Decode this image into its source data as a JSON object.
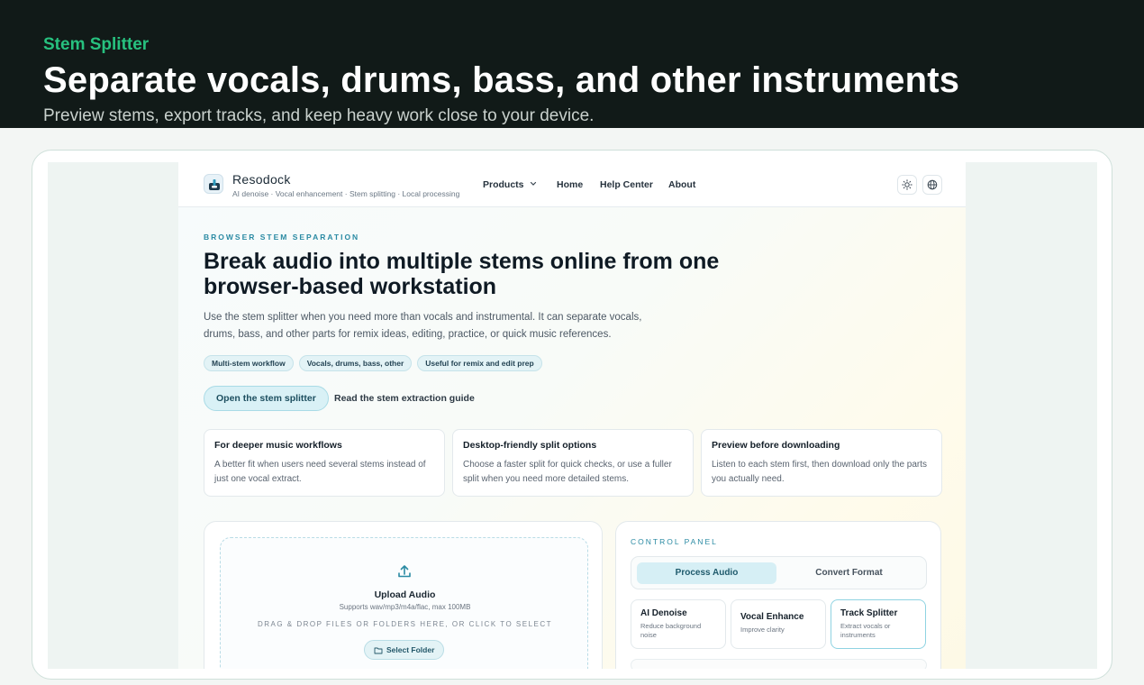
{
  "banner": {
    "eyebrow": "Stem Splitter",
    "headline": "Separate vocals, drums, bass, and other instruments",
    "subtitle": "Preview stems, export tracks, and keep heavy work close to your device."
  },
  "nav": {
    "brand": "Resodock",
    "tagline": "AI denoise · Vocal enhancement · Stem splitting · Local processing",
    "links": {
      "products": "Products",
      "home": "Home",
      "help": "Help Center",
      "about": "About"
    },
    "icons": {
      "theme": "sun-icon",
      "language": "globe-icon",
      "dropdown": "chevron-down-icon"
    }
  },
  "hero": {
    "kicker": "BROWSER STEM SEPARATION",
    "title": "Break audio into multiple stems online from one browser-based workstation",
    "lead": "Use the stem splitter when you need more than vocals and instrumental. It can separate vocals, drums, bass, and other parts for remix ideas, editing, practice, or quick music references.",
    "chips": [
      "Multi-stem workflow",
      "Vocals, drums, bass, other",
      "Useful for remix and edit prep"
    ],
    "primary_cta": "Open the stem splitter",
    "secondary_cta": "Read the stem extraction guide"
  },
  "features": [
    {
      "title": "For deeper music workflows",
      "desc": "A better fit when users need several stems instead of just one vocal extract."
    },
    {
      "title": "Desktop-friendly split options",
      "desc": "Choose a faster split for quick checks, or use a fuller split when you need more detailed stems."
    },
    {
      "title": "Preview before downloading",
      "desc": "Listen to each stem first, then download only the parts you actually need."
    }
  ],
  "upload": {
    "title": "Upload Audio",
    "formats": "Supports wav/mp3/m4a/flac, max 100MB",
    "drop_hint": "DRAG & DROP FILES OR FOLDERS HERE, OR CLICK TO SELECT",
    "folder_button": "Select Folder",
    "icons": {
      "upload": "upload-icon",
      "folder": "folder-icon"
    }
  },
  "control_panel": {
    "label": "CONTROL PANEL",
    "tabs": [
      {
        "label": "Process Audio",
        "active": true
      },
      {
        "label": "Convert Format",
        "active": false
      }
    ],
    "tools": [
      {
        "title": "AI Denoise",
        "desc": "Reduce background noise"
      },
      {
        "title": "Vocal Enhance",
        "desc": "Improve clarity"
      },
      {
        "title": "Track Splitter",
        "desc": "Extract vocals or instruments"
      }
    ],
    "selected_tool": "Track Splitter"
  },
  "colors": {
    "banner_bg": "#111a18",
    "eyebrow": "#27c17f",
    "accent": "#2a8aa3",
    "chip_bg": "#e3f3f6",
    "active_tab": "#d6eff5"
  }
}
